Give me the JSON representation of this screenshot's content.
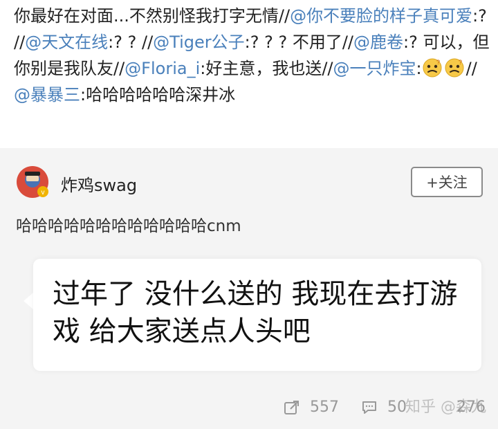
{
  "post": {
    "segments": [
      {
        "text": "你最好在对面...不然别怪我打字无情//",
        "type": "text"
      },
      {
        "text": "@你不要脸的样子真可爱",
        "type": "mention"
      },
      {
        "text": ":? //",
        "type": "text"
      },
      {
        "text": "@天文在线",
        "type": "mention"
      },
      {
        "text": ":? ? //",
        "type": "text"
      },
      {
        "text": "@Tiger公子",
        "type": "mention"
      },
      {
        "text": ":? ? ? 不用了//",
        "type": "text"
      },
      {
        "text": "@鹿卷",
        "type": "mention"
      },
      {
        "text": ":? 可以，但你别是我队友//",
        "type": "text"
      },
      {
        "text": "@Floria_i",
        "type": "mention"
      },
      {
        "text": ":好主意，我也送//",
        "type": "text"
      },
      {
        "text": "@一只炸宝",
        "type": "mention"
      },
      {
        "text": ":",
        "type": "text"
      },
      {
        "text": "thinking-emoji",
        "type": "emoji"
      },
      {
        "text": "thinking-emoji",
        "type": "emoji"
      },
      {
        "text": "//",
        "type": "text"
      },
      {
        "text": "@暴暴三",
        "type": "mention"
      },
      {
        "text": ":哈哈哈哈哈哈深井冰",
        "type": "text"
      }
    ]
  },
  "card": {
    "author": "炸鸡swag",
    "follow_label": "+关注",
    "comment": "哈哈哈哈哈哈哈哈哈哈哈哈cnm",
    "quote": "过年了 没什么送的 我现在去打游戏 给大家送点人头吧",
    "stats": {
      "reposts": "557",
      "comments": "50",
      "likes": "276"
    },
    "watermark": "知乎 @森九"
  },
  "colors": {
    "mention": "#4a80bb",
    "card_bg": "#f4f4f4",
    "follow_border": "#8a8a8a",
    "stats": "#999999"
  },
  "icons": {
    "emoji": "thinking-emoji",
    "repost": "repost-icon",
    "comment": "comment-icon",
    "like": "like-icon"
  }
}
